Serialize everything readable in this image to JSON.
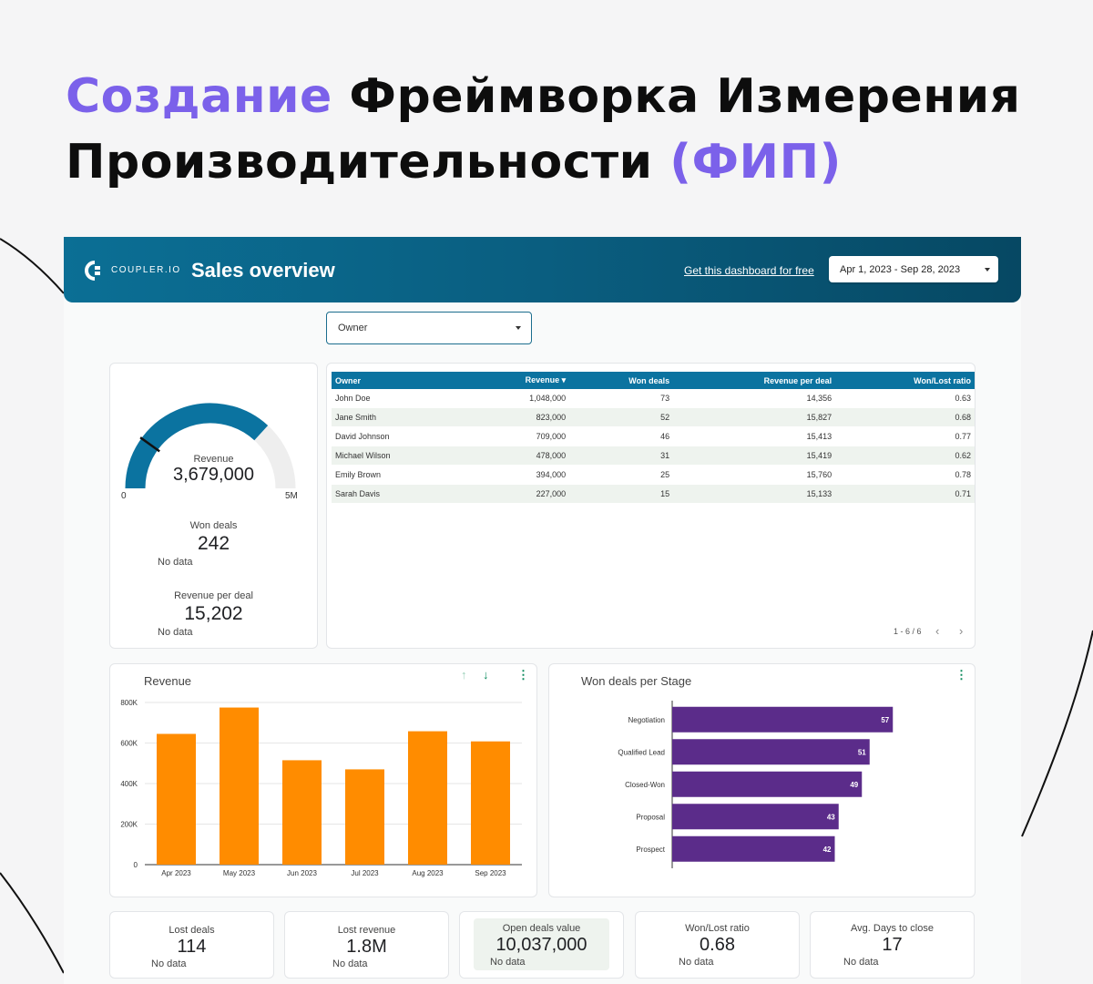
{
  "headline": {
    "accent_start": "Создание",
    "middle": " Фреймворка Измерения Производительности ",
    "accent_end": "(ФИП)"
  },
  "header": {
    "logo_text": "COUPLER.IO",
    "title": "Sales overview",
    "cta_link": "Get this dashboard for free",
    "date_range": "Apr 1, 2023 - Sep 28, 2023",
    "background": "#0a5e80"
  },
  "filters": {
    "owner_label": "Owner"
  },
  "kpi_left": {
    "revenue": {
      "label": "Revenue",
      "value": "3,679,000",
      "min": "0",
      "max": "5M",
      "fraction": 0.7358
    },
    "won_deals": {
      "label": "Won deals",
      "value": "242",
      "nodata": "No data"
    },
    "revenue_per_deal": {
      "label": "Revenue per deal",
      "value": "15,202",
      "nodata": "No data"
    }
  },
  "owners_table": {
    "headers": [
      "Owner",
      "Revenue ▾",
      "Won deals",
      "Revenue per deal",
      "Won/Lost ratio"
    ],
    "rows": [
      [
        "John Doe",
        "1,048,000",
        "73",
        "14,356",
        "0.63"
      ],
      [
        "Jane Smith",
        "823,000",
        "52",
        "15,827",
        "0.68"
      ],
      [
        "David Johnson",
        "709,000",
        "46",
        "15,413",
        "0.77"
      ],
      [
        "Michael Wilson",
        "478,000",
        "31",
        "15,419",
        "0.62"
      ],
      [
        "Emily Brown",
        "394,000",
        "25",
        "15,760",
        "0.78"
      ],
      [
        "Sarah Davis",
        "227,000",
        "15",
        "15,133",
        "0.71"
      ]
    ],
    "pagination": "1 - 6 / 6",
    "header_color": "#0b73a0"
  },
  "chart_data": [
    {
      "type": "bar",
      "title": "Revenue",
      "categories": [
        "Apr 2023",
        "May 2023",
        "Jun 2023",
        "Jul 2023",
        "Aug 2023",
        "Sep 2023"
      ],
      "values": [
        645000,
        775000,
        515000,
        470000,
        658000,
        608000
      ],
      "ylim": [
        0,
        800000
      ],
      "yticks": [
        "0",
        "200K",
        "400K",
        "600K",
        "800K"
      ],
      "ytick_values": [
        0,
        200000,
        400000,
        600000,
        800000
      ],
      "grid": true,
      "color": "#ff8c00"
    },
    {
      "type": "bar",
      "orientation": "horizontal",
      "title": "Won deals per Stage",
      "categories": [
        "Negotiation",
        "Qualified Lead",
        "Closed-Won",
        "Proposal",
        "Prospect"
      ],
      "values": [
        57,
        51,
        49,
        43,
        42
      ],
      "xlim": [
        0,
        60
      ],
      "color": "#5b2c8a"
    }
  ],
  "kpi_bottom": [
    {
      "label": "Lost deals",
      "value": "114",
      "nodata": "No data"
    },
    {
      "label": "Lost revenue",
      "value": "1.8M",
      "nodata": "No data"
    },
    {
      "label": "Open deals value",
      "value": "10,037,000",
      "nodata": "No data"
    },
    {
      "label": "Won/Lost ratio",
      "value": "0.68",
      "nodata": "No data"
    },
    {
      "label": "Avg. Days to close",
      "value": "17",
      "nodata": "No data"
    }
  ],
  "colors": {
    "accent": "#7b61ea",
    "gauge_fill": "#0b73a0",
    "gauge_track": "#eeeeee",
    "bar_orange": "#ff8c00",
    "bar_purple": "#5b2c8a"
  }
}
